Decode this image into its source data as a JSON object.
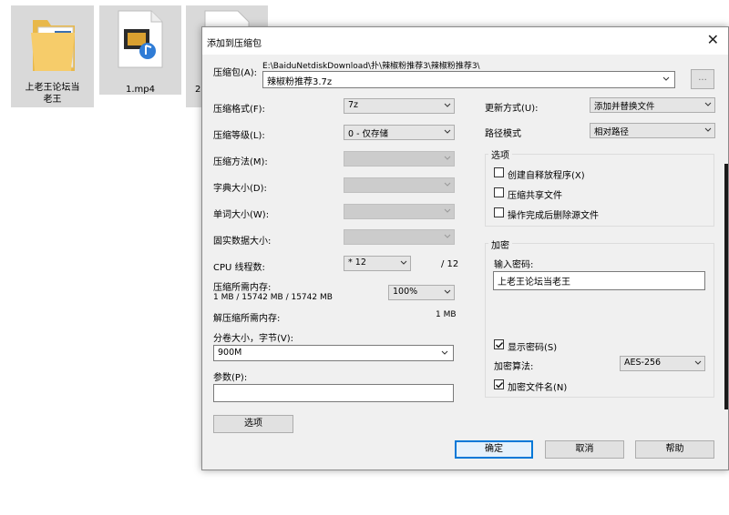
{
  "desktop": {
    "files": [
      {
        "label": "上老王论坛当老王"
      },
      {
        "label": "1.mp4"
      },
      {
        "label": "2"
      }
    ]
  },
  "dialog": {
    "title": "添加到压缩包",
    "archive_label": "压缩包(A):",
    "archive_path": "E:\\BaiduNetdiskDownload\\扑\\辣椒粉推荐3\\辣椒粉推荐3\\",
    "archive_name": "辣椒粉推荐3.7z",
    "browse_label": "...",
    "format_label": "压缩格式(F):",
    "format_value": "7z",
    "level_label": "压缩等级(L):",
    "level_value": "0 - 仅存储",
    "method_label": "压缩方法(M):",
    "dict_label": "字典大小(D):",
    "word_label": "单词大小(W):",
    "solid_label": "固实数据大小:",
    "cpu_label": "CPU 线程数:",
    "cpu_value": "* 12",
    "cpu_total": "/ 12",
    "mem_compress_label": "压缩所需内存:",
    "mem_compress_value": "1 MB / 15742 MB / 15742 MB",
    "mem_percent": "100%",
    "mem_decompress_label": "解压缩所需内存:",
    "mem_decompress_value": "1 MB",
    "volume_label": "分卷大小，字节(V):",
    "volume_value": "900M",
    "params_label": "参数(P):",
    "params_value": "",
    "options_button": "选项",
    "update_label": "更新方式(U):",
    "update_value": "添加并替换文件",
    "path_label": "路径模式",
    "path_value": "相对路径",
    "options_group": "选项",
    "opt_sfx": "创建自释放程序(X)",
    "opt_shared": "压缩共享文件",
    "opt_delete": "操作完成后删除源文件",
    "encrypt_group": "加密",
    "password_label": "输入密码:",
    "password_value": "上老王论坛当老王",
    "show_password": "显示密码(S)",
    "encrypt_method_label": "加密算法:",
    "encrypt_method_value": "AES-256",
    "encrypt_names": "加密文件名(N)",
    "ok_button": "确定",
    "cancel_button": "取消",
    "help_button": "帮助"
  }
}
